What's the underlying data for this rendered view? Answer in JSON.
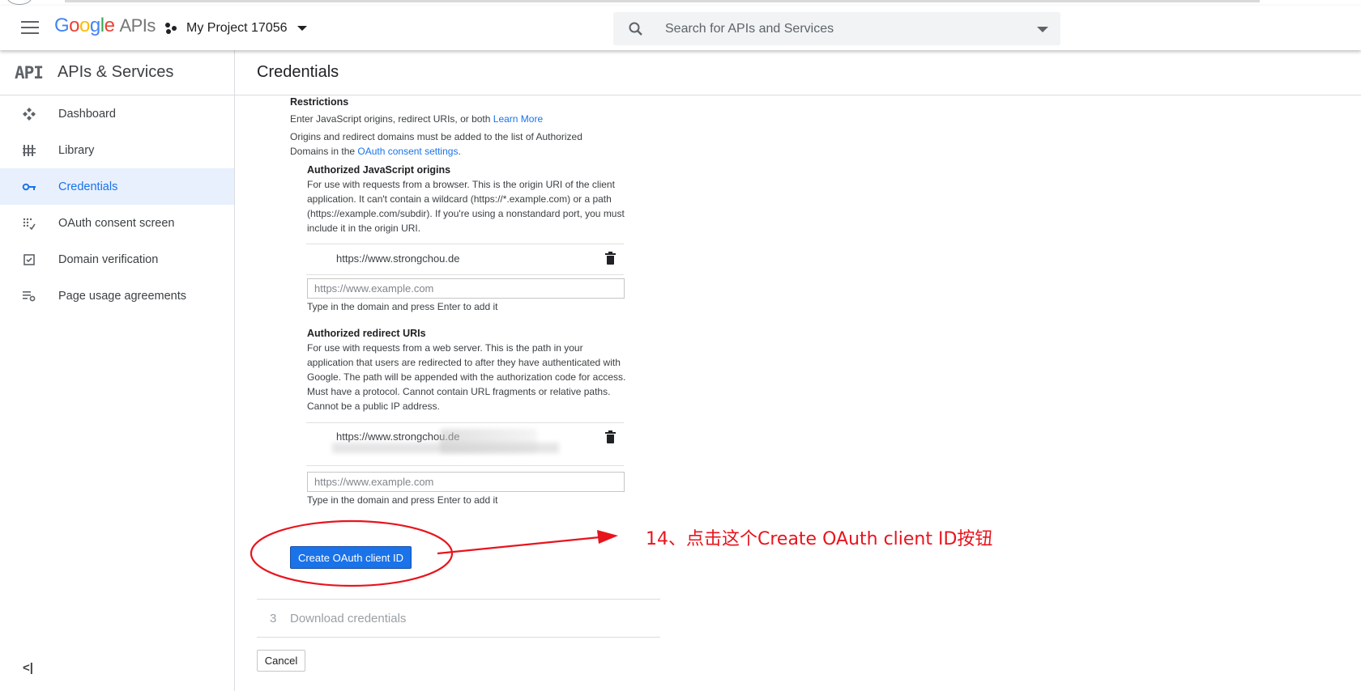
{
  "header": {
    "logo_parts": [
      "G",
      "o",
      "o",
      "g",
      "l",
      "e"
    ],
    "logo_suffix": "APIs",
    "project_name": "My Project 17056",
    "search_placeholder": "Search for APIs and Services"
  },
  "sidebar": {
    "logo": "API",
    "title": "APIs & Services",
    "items": [
      {
        "label": "Dashboard",
        "icon": "dashboard-icon",
        "active": false
      },
      {
        "label": "Library",
        "icon": "library-icon",
        "active": false
      },
      {
        "label": "Credentials",
        "icon": "key-icon",
        "active": true
      },
      {
        "label": "OAuth consent screen",
        "icon": "consent-icon",
        "active": false
      },
      {
        "label": "Domain verification",
        "icon": "checkbox-icon",
        "active": false
      },
      {
        "label": "Page usage agreements",
        "icon": "settings-list-icon",
        "active": false
      }
    ],
    "collapse_label": "<|"
  },
  "main": {
    "title": "Credentials",
    "restrictions": {
      "title": "Restrictions",
      "line1_text": "Enter JavaScript origins, redirect URIs, or both ",
      "line1_link": "Learn More",
      "line2_text": "Origins and redirect domains must be added to the list of Authorized Domains in the ",
      "line2_link": "OAuth consent settings",
      "line2_end": "."
    },
    "js_origins": {
      "title": "Authorized JavaScript origins",
      "description": "For use with requests from a browser. This is the origin URI of the client application. It can't contain a wildcard (https://*.example.com) or a path (https://example.com/subdir). If you're using a nonstandard port, you must include it in the origin URI.",
      "entries": [
        "https://www.strongchou.de"
      ],
      "input_placeholder": "https://www.example.com",
      "hint": "Type in the domain and press Enter to add it"
    },
    "redirect_uris": {
      "title": "Authorized redirect URIs",
      "description": "For use with requests from a web server. This is the path in your application that users are redirected to after they have authenticated with Google. The path will be appended with the authorization code for access. Must have a protocol. Cannot contain URL fragments or relative paths. Cannot be a public IP address.",
      "entries": [
        "https://www.strongchou.de"
      ],
      "input_placeholder": "https://www.example.com",
      "hint": "Type in the domain and press Enter to add it"
    },
    "create_button": "Create OAuth client ID",
    "step3": {
      "number": "3",
      "label": "Download credentials"
    },
    "cancel_button": "Cancel"
  },
  "annotation": {
    "text": "14、点击这个Create OAuth client ID按钮",
    "color": "#e8141d"
  },
  "colors": {
    "accent": "#1a73e8",
    "active_bg": "#e8f0fe"
  }
}
